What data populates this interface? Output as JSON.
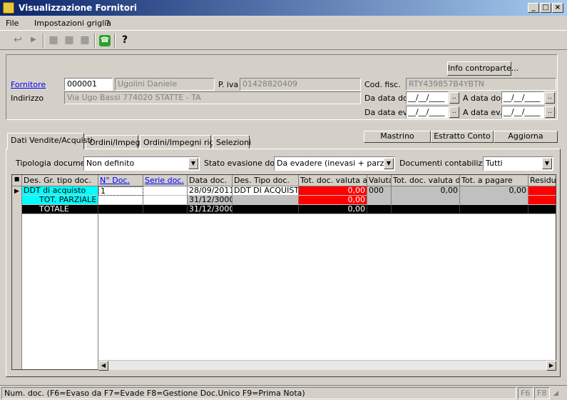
{
  "window": {
    "title": "Visualizzazione Fornitori"
  },
  "menu": [
    "File",
    "Impostazioni griglia",
    "?"
  ],
  "header": {
    "fornitore_label": "Fornitore",
    "fornitore_code": "000001",
    "fornitore_name": "Ugolini Daniele",
    "piva_label": "P. iva",
    "piva_value": "01428820409",
    "codfisc_label": "Cod. fisc.",
    "codfisc_value": "RTY439857B4YBTN",
    "indirizzo_label": "Indirizzo",
    "indirizzo_value": "Via Ugo Bassi  774020  STATTE  - TA",
    "info_button": "Info controparte...",
    "da_data_doc_label": "Da data doc.",
    "a_data_doc_label": "A data doc.",
    "da_data_ev_label": "Da data ev.",
    "a_data_ev_label": "A data ev.",
    "date_placeholder": "__/__/____",
    "dots": ".."
  },
  "tabs": [
    "Dati Vendite/Acquisti",
    "Ordini/Impegni",
    "Ordini/Impegni righe",
    "Selezioni"
  ],
  "actions": {
    "mastrino": "Mastrino",
    "estratto": "Estratto Conto",
    "aggiorna": "Aggiorna"
  },
  "filters": {
    "tipologia_label": "Tipologia documenti",
    "tipologia_value": "Non definito",
    "stato_label": "Stato evasione doc.",
    "stato_value": "Da evadere (inevasi + parz. Evasi",
    "contab_label": "Documenti contabilizzati",
    "contab_value": "Tutti"
  },
  "grid": {
    "headers": [
      "Des. Gr. tipo doc.",
      "N° Doc.",
      "Serie doc.",
      "Data doc.",
      "Des. Tipo doc.",
      "Tot. doc. valuta azi.",
      "Valuta",
      "Tot. doc. valuta doc",
      "Tot. a pagare",
      "Residuo"
    ],
    "rows": [
      [
        "DDT di acquisto",
        "1",
        "",
        "28/09/2011",
        "DDT DI ACQUISTO",
        "0,00",
        "000",
        "0,00",
        "0,00",
        ""
      ],
      [
        "TOT. PARZIALE",
        "",
        "",
        "31/12/3000",
        "",
        "0,00",
        "",
        "",
        "",
        ""
      ],
      [
        "TOTALE",
        "",
        "",
        "31/12/3000",
        "",
        "0,00",
        "",
        "",
        "",
        ""
      ]
    ]
  },
  "status": {
    "text": "Num. doc. (F6=Evaso da   F7=Evade   F8=Gestione Doc.Unico   F9=Prima Nota)",
    "f6": "F6",
    "f8": "F8"
  },
  "colors": {
    "accent": "#0a246a",
    "red": "#ff0000",
    "cyan": "#00ffff",
    "link": "#0000ff"
  }
}
